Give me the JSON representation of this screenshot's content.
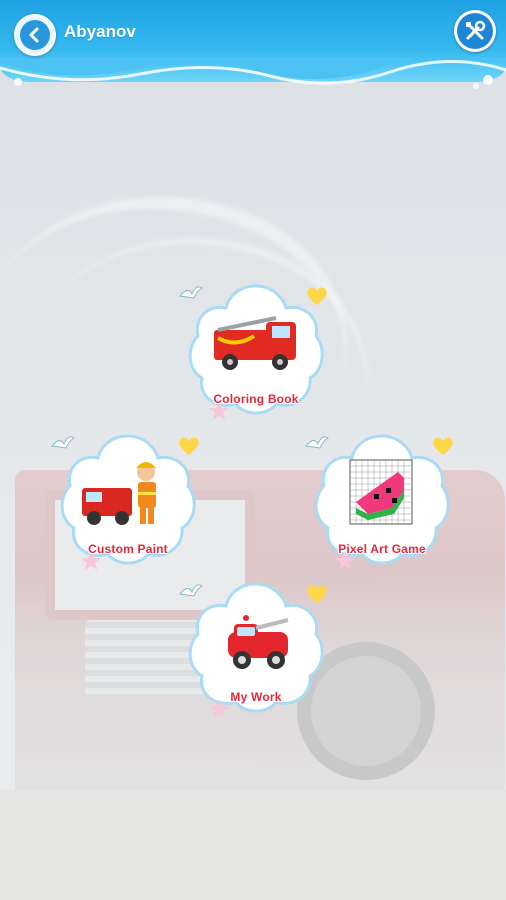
{
  "header": {
    "title": "Abyanov",
    "back_icon": "back-arrow-icon",
    "tools_icon": "tools-icon"
  },
  "menu": {
    "items": [
      {
        "label": "Coloring Book",
        "icon": "fire-truck-icon"
      },
      {
        "label": "Custom Paint",
        "icon": "firefighter-truck-icon"
      },
      {
        "label": "Pixel Art Game",
        "icon": "watermelon-pixel-icon"
      },
      {
        "label": "My Work",
        "icon": "cartoon-fire-truck-icon"
      }
    ]
  },
  "colors": {
    "header": "#1ea2e3",
    "label": "#e6283a",
    "heart": "#ffd84a"
  }
}
